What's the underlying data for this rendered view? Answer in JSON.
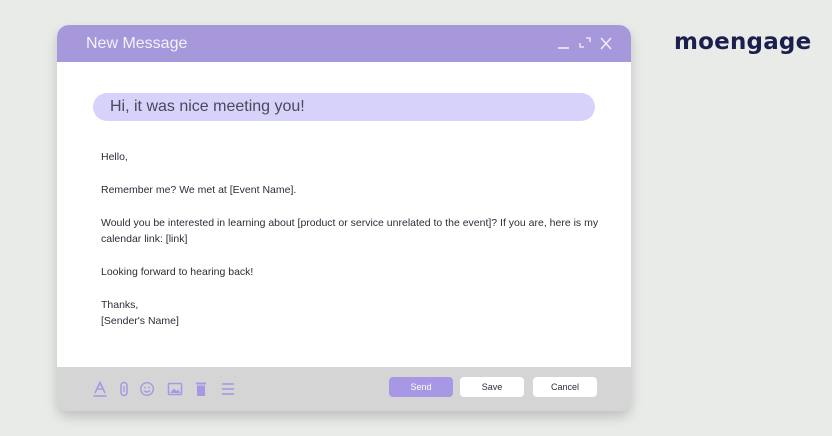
{
  "brand": {
    "logo_text": "moengage"
  },
  "window": {
    "title": "New Message",
    "controls": [
      "minimize-icon",
      "maximize-icon",
      "close-icon"
    ]
  },
  "email": {
    "subject": "Hi, it was nice meeting you!",
    "body": {
      "greeting": "Hello,",
      "line1": "Remember me? We met at [Event Name].",
      "line2": "Would you be interested in learning about [product or service unrelated to the event]? If you are, here is my calendar link: [link]",
      "line3": "Looking forward to hearing back!",
      "closing": "Thanks,",
      "signature": "[Sender's Name]"
    }
  },
  "toolbar": {
    "icons": [
      "text-format-icon",
      "attachment-icon",
      "emoji-icon",
      "image-icon",
      "delete-icon",
      "more-options-icon"
    ],
    "send_label": "Send",
    "save_label": "Save",
    "cancel_label": "Cancel"
  },
  "colors": {
    "accent": "#a798dc",
    "subject_pill": "#d6d2fa",
    "send_button": "#a897e4",
    "toolbar_bg": "#d4d5d4",
    "page_bg": "#e9ebe9",
    "logo": "#1b1f4d"
  }
}
